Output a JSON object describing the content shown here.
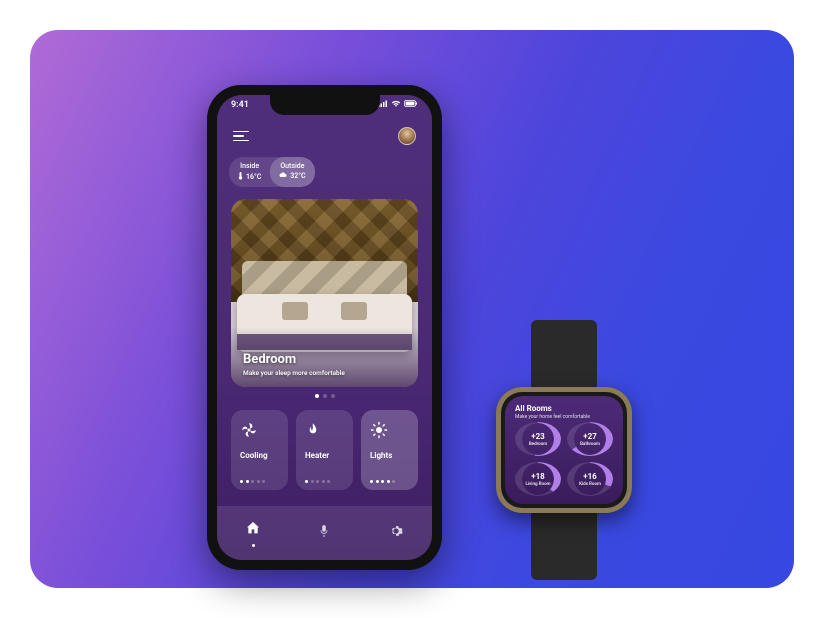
{
  "phone": {
    "status": {
      "time": "9:41"
    },
    "env": {
      "inside": {
        "label": "Inside",
        "value": "16°C"
      },
      "outside": {
        "label": "Outside",
        "value": "32°C"
      }
    },
    "room": {
      "title": "Bedroom",
      "subtitle": "Make your sleep more comfortable"
    },
    "tiles": {
      "cooling": {
        "label": "Cooling"
      },
      "heater": {
        "label": "Heater"
      },
      "lights": {
        "label": "Lights"
      }
    }
  },
  "watch": {
    "title": "All Rooms",
    "subtitle": "Make your home feel comfortable",
    "rooms": {
      "r0": {
        "temp": "+23",
        "name": "Bedroom"
      },
      "r1": {
        "temp": "+27",
        "name": "Bathroom"
      },
      "r2": {
        "temp": "+18",
        "name": "Living Room"
      },
      "r3": {
        "temp": "+16",
        "name": "Kids Room"
      }
    }
  }
}
